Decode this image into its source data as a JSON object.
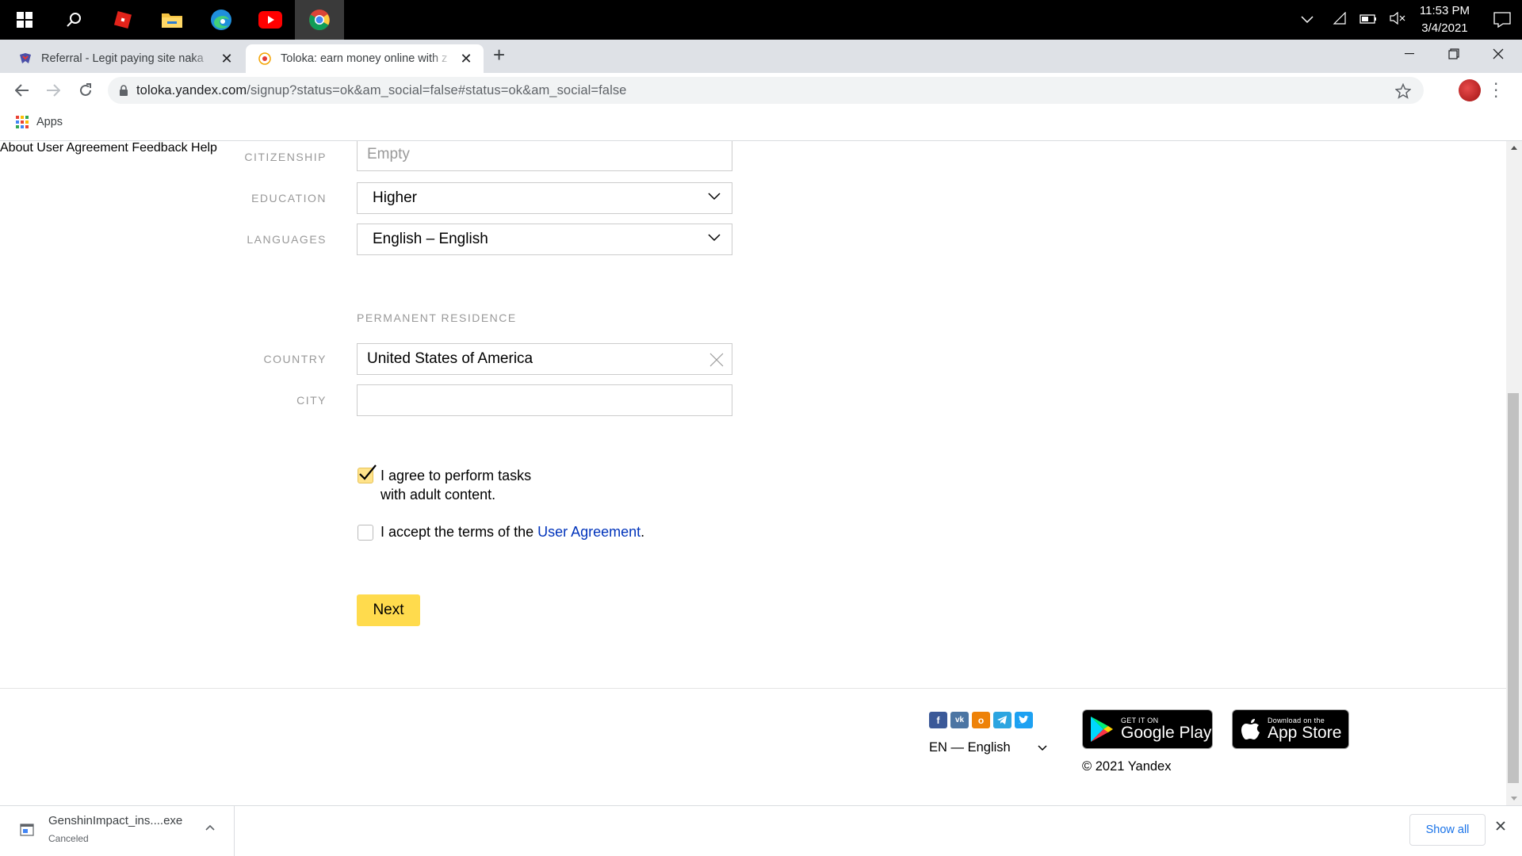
{
  "taskbar": {
    "apps": [
      "windows-start",
      "search",
      "roblox",
      "file-explorer",
      "edge",
      "youtube",
      "chrome"
    ],
    "clock_time": "11:53 PM",
    "clock_date": "3/4/2021"
  },
  "tabs": [
    {
      "title": "Referral - Legit paying site naka",
      "active": false
    },
    {
      "title": "Toloka: earn money online with z",
      "active": true
    }
  ],
  "address_bar": {
    "host": "toloka.yandex.com",
    "path": "/signup?status=ok&am_social=false#status=ok&am_social=false"
  },
  "bookmarks": {
    "apps_label": "Apps"
  },
  "form": {
    "citizenship": {
      "label": "CITIZENSHIP",
      "placeholder": "Empty"
    },
    "education": {
      "label": "EDUCATION",
      "value": "Higher"
    },
    "languages": {
      "label": "LANGUAGES",
      "value": "English – English"
    },
    "permanent_residence_title": "PERMANENT RESIDENCE",
    "country": {
      "label": "COUNTRY",
      "value": "United States of America"
    },
    "city": {
      "label": "CITY",
      "value": ""
    },
    "adult_content": {
      "line1": "I agree to perform tasks",
      "line2": "with adult content.",
      "checked": true
    },
    "terms": {
      "text": "I accept the terms of the ",
      "link": "User Agreement",
      "suffix": ".",
      "checked": false
    },
    "next_label": "Next"
  },
  "footer": {
    "about": "About",
    "user_agreement": "User Agreement",
    "feedback": "Feedback",
    "help": "Help",
    "social": [
      "facebook",
      "vk",
      "odnoklassniki",
      "telegram",
      "twitter"
    ],
    "language": "EN — English",
    "google_play_small": "GET IT ON",
    "google_play_big": "Google Play",
    "app_store_small": "Download on the",
    "app_store_big": "App Store",
    "copyright": "© 2021 Yandex"
  },
  "downloads": {
    "file_name": "GenshinImpact_ins....exe",
    "status": "Canceled",
    "show_all": "Show all"
  },
  "colors": {
    "accent_yellow": "#ffdb4d",
    "link_blue": "#0033bb",
    "chrome_blue": "#1a73e8"
  }
}
